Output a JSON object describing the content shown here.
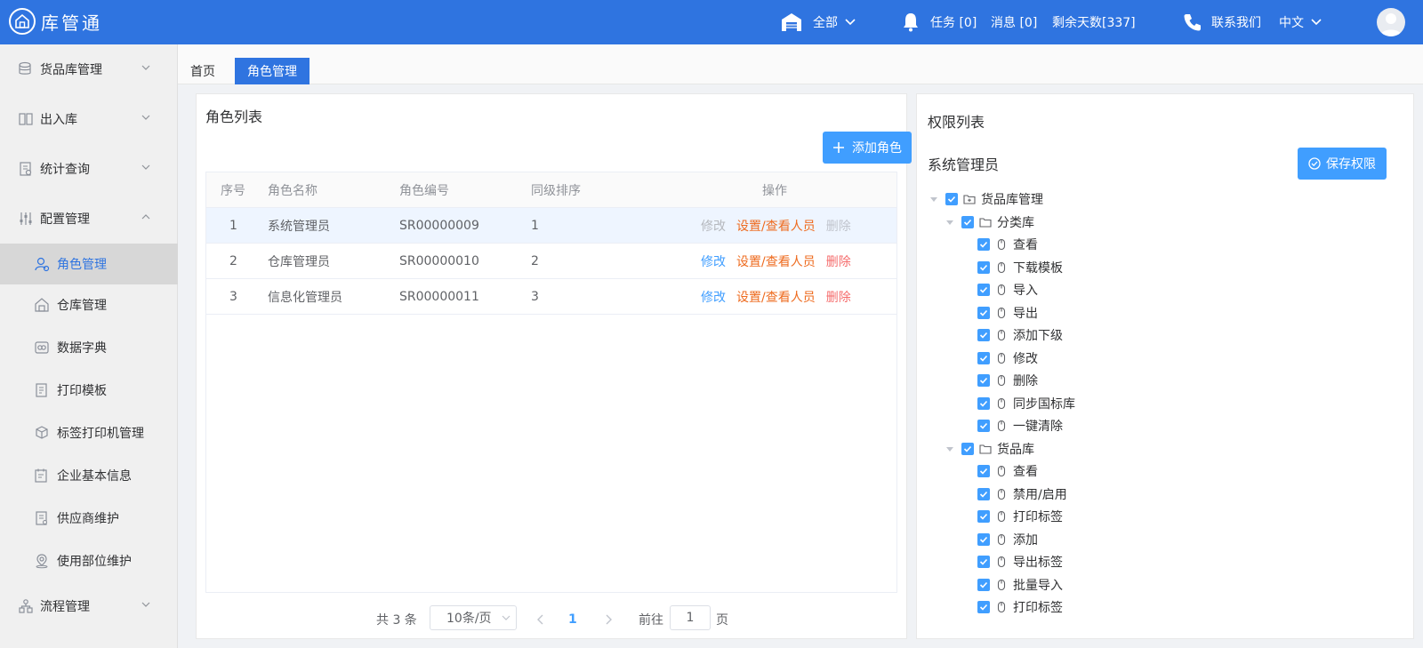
{
  "header": {
    "logo_text": "库管通",
    "warehouse_label": "全部",
    "tasks": "任务 [0]",
    "messages": "消息 [0]",
    "remaining_days": "剩余天数[337]",
    "contact": "联系我们",
    "language": "中文"
  },
  "sidebar": {
    "groups": [
      {
        "label": "货品库管理"
      },
      {
        "label": "出入库"
      },
      {
        "label": "统计查询"
      },
      {
        "label": "配置管理"
      },
      {
        "label": "流程管理"
      }
    ],
    "config_items": [
      {
        "label": "角色管理",
        "icon": "user-roles-icon"
      },
      {
        "label": "仓库管理",
        "icon": "warehouse-icon"
      },
      {
        "label": "数据字典",
        "icon": "dictionary-icon"
      },
      {
        "label": "打印模板",
        "icon": "print-template-icon"
      },
      {
        "label": "标签打印机管理",
        "icon": "cube-icon"
      },
      {
        "label": "企业基本信息",
        "icon": "calendar-icon"
      },
      {
        "label": "供应商维护",
        "icon": "document-icon"
      },
      {
        "label": "使用部位维护",
        "icon": "location-icon"
      }
    ]
  },
  "tabs": {
    "home": "首页",
    "active": "角色管理"
  },
  "roles_panel": {
    "title": "角色列表",
    "add_button": "添加角色",
    "columns": [
      "序号",
      "角色名称",
      "角色编号",
      "同级排序",
      "操作"
    ],
    "rows": [
      {
        "index": "1",
        "name": "系统管理员",
        "code": "SR00000009",
        "sort": "1"
      },
      {
        "index": "2",
        "name": "仓库管理员",
        "code": "SR00000010",
        "sort": "2"
      },
      {
        "index": "3",
        "name": "信息化管理员",
        "code": "SR00000011",
        "sort": "3"
      }
    ],
    "actions": {
      "edit": "修改",
      "set": "设置/查看人员",
      "delete": "删除"
    },
    "pagination": {
      "total": "共 3 条",
      "page_size": "10条/页",
      "current_page": "1",
      "goto_label": "前往",
      "goto_value": "1",
      "page_suffix": "页"
    }
  },
  "perm_panel": {
    "title": "权限列表",
    "role_name": "系统管理员",
    "save_button": "保存权限",
    "tree": {
      "root": "货品库管理",
      "groups": [
        {
          "label": "分类库",
          "children": [
            "查看",
            "下载模板",
            "导入",
            "导出",
            "添加下级",
            "修改",
            "删除",
            "同步国标库",
            "一键清除"
          ]
        },
        {
          "label": "货品库",
          "children": [
            "查看",
            "禁用/启用",
            "打印标签",
            "添加",
            "导出标签",
            "批量导入",
            "打印标签"
          ]
        }
      ]
    }
  },
  "colors": {
    "header_blue": "#2f74e0",
    "primary": "#409eff",
    "orange": "#ee6b1f",
    "danger": "#f56c6c"
  }
}
